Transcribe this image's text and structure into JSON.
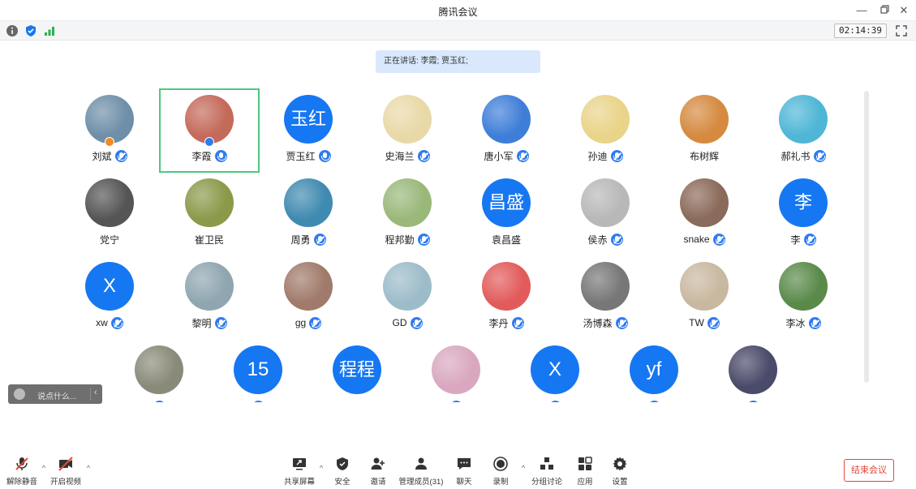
{
  "window": {
    "title": "腾讯会议"
  },
  "status": {
    "timer": "02:14:39"
  },
  "speaking": {
    "text": "正在讲话: 李霞; 贾玉红;"
  },
  "participants": [
    {
      "name": "刘斌",
      "avatar": "photo",
      "bg": "#6f8fa8",
      "mic": "muted",
      "host": true
    },
    {
      "name": "李霞",
      "avatar": "photo",
      "bg": "#c46a5a",
      "mic": "active",
      "active": true,
      "cohost": true
    },
    {
      "name": "贾玉红",
      "avatar": "玉红",
      "mic": "active"
    },
    {
      "name": "史海兰",
      "avatar": "photo",
      "bg": "#e9d9a8",
      "mic": "muted"
    },
    {
      "name": "唐小军",
      "avatar": "photo",
      "bg": "#3f7ed8",
      "mic": "muted"
    },
    {
      "name": "孙迪",
      "avatar": "photo",
      "bg": "#e9d48a",
      "mic": "muted"
    },
    {
      "name": "布树辉",
      "avatar": "photo",
      "bg": "#d58a40",
      "mic": "none"
    },
    {
      "name": "郝礼书",
      "avatar": "photo",
      "bg": "#4fb6d6",
      "mic": "muted"
    },
    {
      "name": "党宁",
      "avatar": "photo",
      "bg": "#555555",
      "mic": "none"
    },
    {
      "name": "崔卫民",
      "avatar": "photo",
      "bg": "#8a9a4a",
      "mic": "none"
    },
    {
      "name": "周勇",
      "avatar": "photo",
      "bg": "#3f8ab0",
      "mic": "muted"
    },
    {
      "name": "程邦勤",
      "avatar": "photo",
      "bg": "#9ab87a",
      "mic": "muted"
    },
    {
      "name": "袁昌盛",
      "avatar": "昌盛",
      "mic": "none"
    },
    {
      "name": "侯赤",
      "avatar": "photo",
      "bg": "#b8b8b8",
      "mic": "muted"
    },
    {
      "name": "snake",
      "avatar": "photo",
      "bg": "#8a6a5a",
      "mic": "muted"
    },
    {
      "name": "李",
      "avatar": "李",
      "mic": "muted"
    },
    {
      "name": "xw",
      "avatar": "X",
      "mic": "muted"
    },
    {
      "name": "黎明",
      "avatar": "photo",
      "bg": "#8fa6b0",
      "mic": "muted"
    },
    {
      "name": "gg",
      "avatar": "photo",
      "bg": "#a07a6a",
      "mic": "muted"
    },
    {
      "name": "GD",
      "avatar": "photo",
      "bg": "#9dbcc9",
      "mic": "muted"
    },
    {
      "name": "李丹",
      "avatar": "photo",
      "bg": "#e25b5b",
      "mic": "muted"
    },
    {
      "name": "汤博森",
      "avatar": "photo",
      "bg": "#777777",
      "mic": "muted"
    },
    {
      "name": "TW",
      "avatar": "photo",
      "bg": "#c8b8a0",
      "mic": "muted"
    },
    {
      "name": "李冰",
      "avatar": "photo",
      "bg": "#5a8a4a",
      "mic": "muted"
    },
    {
      "name": "",
      "avatar": "photo",
      "bg": "#8a8a7a",
      "mic": "muted"
    },
    {
      "name": "",
      "avatar": "15",
      "mic": "muted"
    },
    {
      "name": "",
      "avatar": "程程",
      "mic": "none"
    },
    {
      "name": "",
      "avatar": "photo",
      "bg": "#d9a8c0",
      "mic": "muted"
    },
    {
      "name": "",
      "avatar": "X",
      "mic": "muted"
    },
    {
      "name": "",
      "avatar": "yf",
      "mic": "muted"
    },
    {
      "name": "",
      "avatar": "photo",
      "bg": "#4a4a6a",
      "mic": "muted"
    }
  ],
  "chat": {
    "placeholder": "说点什么..."
  },
  "toolbar": {
    "unmute": "解除静音",
    "start_video": "开启视频",
    "share_screen": "共享屏幕",
    "security": "安全",
    "invite": "邀请",
    "manage_members": "管理成员(31)",
    "chat": "聊天",
    "record": "录制",
    "breakout": "分组讨论",
    "apps": "应用",
    "settings": "设置",
    "end_meeting": "结束会议"
  },
  "colors": {
    "accent": "#1677f2",
    "active_border": "#4cc97d",
    "end": "#e0493c",
    "banner": "#d9e8fc"
  }
}
